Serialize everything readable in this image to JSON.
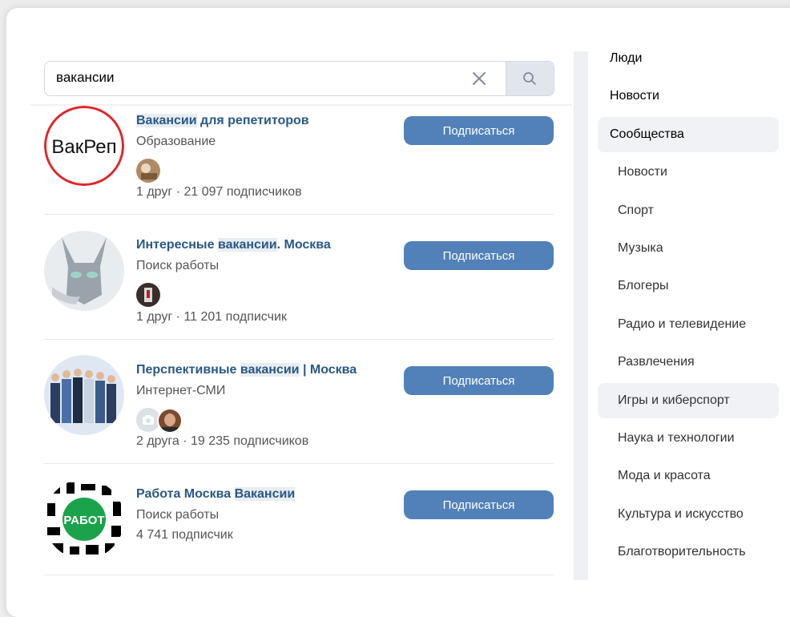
{
  "search": {
    "value": "вакансии"
  },
  "results": [
    {
      "name_hl": "Вакансии",
      "name_rest": " для репетиторов",
      "category": "Образование",
      "stats": "1 друг · 21 097 подписчиков",
      "button": "Подписаться",
      "avatar_text": "ВакРеп"
    },
    {
      "name_pre": "Интересные ",
      "name_hl": "вакансии",
      "name_rest": ". Москва",
      "category": "Поиск работы",
      "stats": "1 друг · 11 201 подписчик",
      "button": "Подписаться"
    },
    {
      "name_pre": "Перспективные ",
      "name_hl": "вакансии",
      "name_rest": " | Москва",
      "category": "Интернет-СМИ",
      "stats": "2 друга · 19 235 подписчиков",
      "button": "Подписаться"
    },
    {
      "name_pre": "Работа Москва ",
      "name_hl": "Вакансии",
      "category": "Поиск работы",
      "stats": "4 741 подписчик",
      "button": "Подписаться",
      "avatar_text": "РАБОТ"
    }
  ],
  "menu": {
    "people": "Люди",
    "news": "Новости",
    "communities": "Сообщества",
    "sub": [
      "Новости",
      "Спорт",
      "Музыка",
      "Блогеры",
      "Радио и телевидение",
      "Развлечения",
      "Игры и киберспорт",
      "Наука и технологии",
      "Мода и красота",
      "Культура и искусство",
      "Благотворительность"
    ]
  },
  "colors": {
    "accent": "#5181b8",
    "link": "#2a5885",
    "highlight": "#e7edf3"
  }
}
